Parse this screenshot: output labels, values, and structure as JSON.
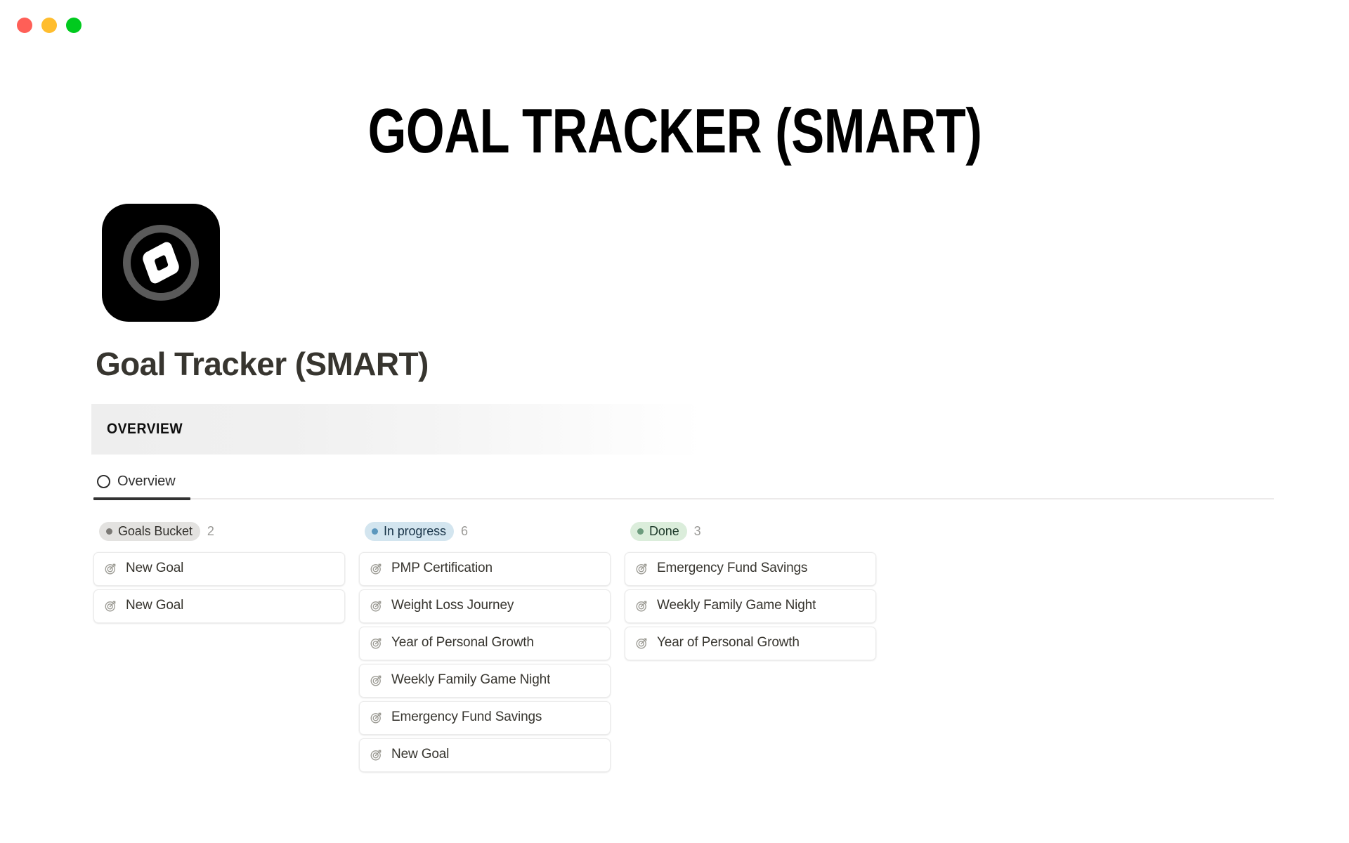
{
  "window": {
    "traffic_lights": [
      {
        "name": "close",
        "color": "#ff5f57"
      },
      {
        "name": "minimize",
        "color": "#ffbd2e"
      },
      {
        "name": "maximize",
        "color": "#00ca1e"
      }
    ]
  },
  "hero": {
    "title": "GOAL TRACKER (SMART)"
  },
  "page": {
    "icon_name": "compass-diamond-app-icon",
    "title": "Goal Tracker (SMART)",
    "section_band_label": "OVERVIEW"
  },
  "tabs": [
    {
      "label": "Overview",
      "icon": "circle-icon",
      "active": true
    }
  ],
  "board": {
    "columns": [
      {
        "status": "Goals Bucket",
        "count": "2",
        "pill_bg": "#e3e2e0",
        "pill_text": "#32302c",
        "dot_color": "#7c7a76",
        "cards": [
          {
            "icon": "target-icon",
            "title": "New Goal"
          },
          {
            "icon": "target-icon",
            "title": "New Goal"
          }
        ]
      },
      {
        "status": "In progress",
        "count": "6",
        "pill_bg": "#d3e5ef",
        "pill_text": "#183347",
        "dot_color": "#5b97bd",
        "cards": [
          {
            "icon": "target-icon",
            "title": "PMP Certification"
          },
          {
            "icon": "target-icon",
            "title": "Weight Loss Journey"
          },
          {
            "icon": "target-icon",
            "title": "Year of Personal Growth"
          },
          {
            "icon": "target-icon",
            "title": "Weekly Family Game Night"
          },
          {
            "icon": "target-icon",
            "title": "Emergency Fund Savings"
          },
          {
            "icon": "target-icon",
            "title": "New Goal"
          }
        ]
      },
      {
        "status": "Done",
        "count": "3",
        "pill_bg": "#dbeddb",
        "pill_text": "#1c3829",
        "dot_color": "#6c9b7d",
        "cards": [
          {
            "icon": "target-icon",
            "title": "Emergency Fund Savings"
          },
          {
            "icon": "target-icon",
            "title": "Weekly Family Game Night"
          },
          {
            "icon": "target-icon",
            "title": "Year of Personal Growth"
          }
        ]
      }
    ]
  }
}
